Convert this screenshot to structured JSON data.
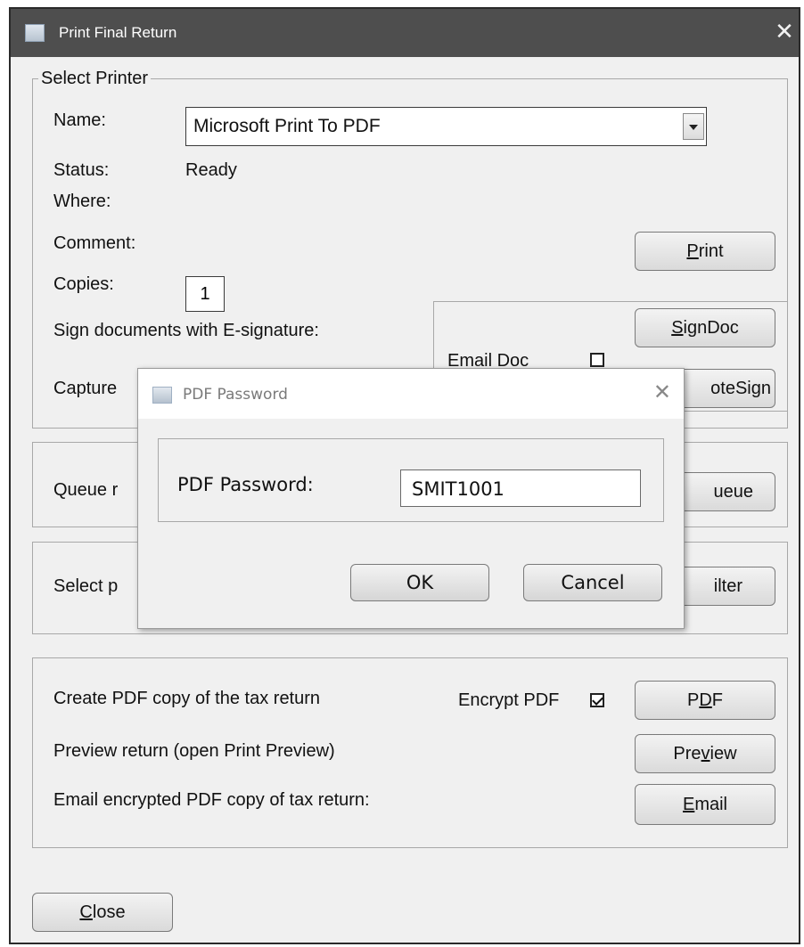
{
  "window": {
    "title": "Print Final Return"
  },
  "printer": {
    "legend": "Select Printer",
    "name_label": "Name:",
    "name_value": "Microsoft Print To PDF",
    "status_label": "Status:",
    "status_value": "Ready",
    "where_label": "Where:",
    "comment_label": "Comment:",
    "copies_label": "Copies:",
    "copies_value": "1",
    "sign_label": "Sign documents with E-signature:",
    "capture_label": "Capture",
    "email_doc_label": "Email Doc",
    "email_doc_checked": false,
    "print_button": {
      "pre": "",
      "key": "P",
      "post": "rint"
    },
    "signdoc_button": {
      "pre": "",
      "key": "S",
      "post": "ignDoc"
    },
    "remotesign_button_label": "oteSign"
  },
  "queue": {
    "label": "Queue r",
    "button_label": "ueue"
  },
  "select": {
    "label": "Select p",
    "button_label": "ilter"
  },
  "pdf_section": {
    "create_label": "Create PDF copy of the tax return",
    "encrypt_label": "Encrypt PDF",
    "encrypt_checked": true,
    "pdf_button": {
      "pre": "P",
      "key": "D",
      "post": "F"
    },
    "preview_label": "Preview return (open Print Preview)",
    "preview_button": {
      "pre": "Pre",
      "key": "v",
      "post": "iew"
    },
    "email_label": "Email encrypted PDF copy of tax return:",
    "email_button": {
      "pre": "",
      "key": "E",
      "post": "mail"
    }
  },
  "close_button": {
    "pre": "",
    "key": "C",
    "post": "lose"
  },
  "modal": {
    "title": "PDF Password",
    "field_label": "PDF Password:",
    "field_value": "SMIT1001",
    "ok_label": "OK",
    "cancel_label": "Cancel"
  }
}
